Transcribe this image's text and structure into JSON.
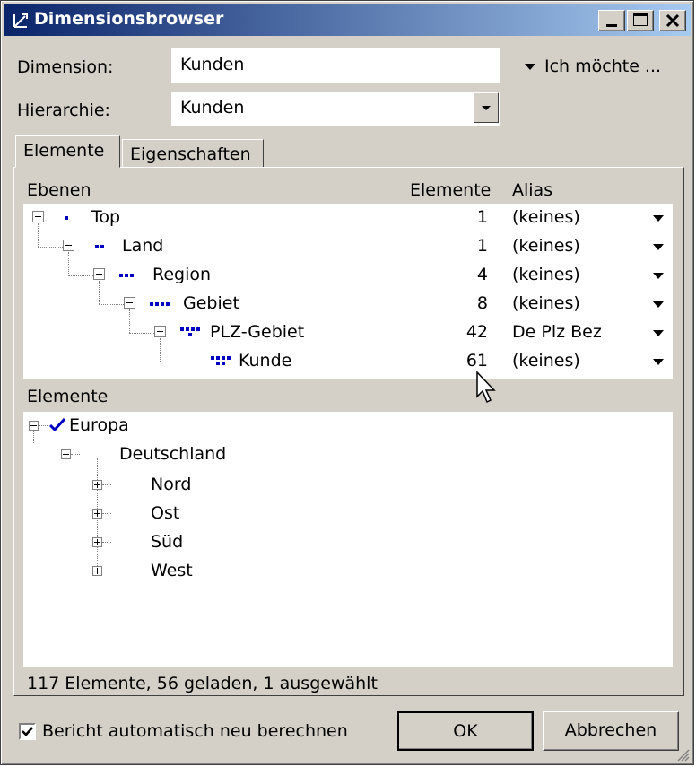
{
  "window": {
    "title": "Dimensionsbrowser"
  },
  "form": {
    "dimension_label": "Dimension:",
    "dimension_value": "Kunden",
    "hierarchy_label": "Hierarchie:",
    "hierarchy_value": "Kunden",
    "action_menu": "Ich möchte ..."
  },
  "tabs": [
    {
      "label": "Elemente",
      "active": true
    },
    {
      "label": "Eigenschaften",
      "active": false
    }
  ],
  "levels": {
    "header_levels": "Ebenen",
    "header_elements": "Elemente",
    "header_alias": "Alias",
    "rows": [
      {
        "name": "Top",
        "count": "1",
        "alias": "(keines)"
      },
      {
        "name": "Land",
        "count": "1",
        "alias": "(keines)"
      },
      {
        "name": "Region",
        "count": "4",
        "alias": "(keines)"
      },
      {
        "name": "Gebiet",
        "count": "8",
        "alias": "(keines)"
      },
      {
        "name": "PLZ-Gebiet",
        "count": "42",
        "alias": "De Plz Bez"
      },
      {
        "name": "Kunde",
        "count": "61",
        "alias": "(keines)"
      }
    ]
  },
  "elements": {
    "header": "Elemente",
    "tree": [
      {
        "label": "Europa",
        "checked": true
      },
      {
        "label": "Deutschland"
      },
      {
        "label": "Nord"
      },
      {
        "label": "Ost"
      },
      {
        "label": "Süd"
      },
      {
        "label": "West"
      }
    ],
    "status": "117 Elemente, 56 geladen, 1 ausgewählt"
  },
  "footer": {
    "recalc_label": "Bericht automatisch neu berechnen",
    "recalc_checked": true,
    "ok_label": "OK",
    "cancel_label": "Abbrechen"
  },
  "colors": {
    "title_start": "#0a246a",
    "title_end": "#a6caf0",
    "level_icon": "#0000c0",
    "check": "#0000c0"
  }
}
